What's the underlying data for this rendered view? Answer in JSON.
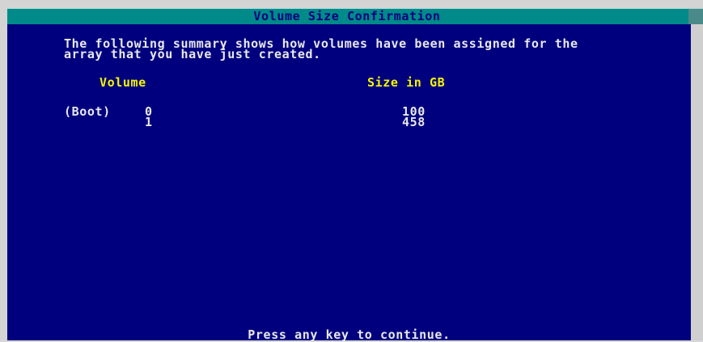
{
  "dialog": {
    "title": "Volume Size Confirmation",
    "summary_line_1": "The following summary shows how volumes have been assigned for the",
    "summary_line_2": "array that you have just created."
  },
  "table": {
    "columns": [
      "Volume",
      "Size in GB"
    ],
    "rows": [
      {
        "tag": "(Boot)",
        "volume": "0",
        "size": "100"
      },
      {
        "tag": "",
        "volume": "1",
        "size": "458"
      }
    ]
  },
  "footer": {
    "prompt": "Press any key to continue."
  },
  "colors": {
    "background": "#00007f",
    "title_bar": "#008a8a",
    "header_text": "#f5f500",
    "body_text": "#e8e8e8"
  }
}
